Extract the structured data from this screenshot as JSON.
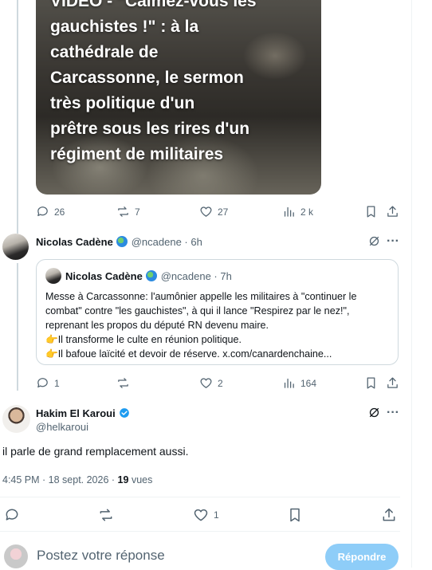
{
  "media_card": {
    "caption_lines": [
      "VIDÉO - \"Calmez-vous les",
      "gauchistes !\" : à la",
      "cathédrale de",
      "Carcassonne, le sermon",
      "très politique d'un",
      "prêtre sous les rires d'un",
      "régiment de militaires"
    ]
  },
  "post1_actions": {
    "replies": "26",
    "reposts": "7",
    "likes": "27",
    "views": "2 k"
  },
  "reply_post": {
    "author_name": "Nicolas Cadène",
    "handle_time": "@ncadene · 6h",
    "quote": {
      "author_name": "Nicolas Cadène",
      "handle_time": "@ncadene · 7h",
      "lines": [
        "Messe à Carcassonne: l'aumônier appelle les militaires à \"continuer le",
        "combat\" contre \"les gauchistes\", à qui il lance \"Respirez par le nez!\",",
        "reprenant les propos du député RN devenu maire.",
        "Il transforme le culte en réunion politique.",
        "Il bafoue laïcité et devoir de réserve. x.com/canardenchaine..."
      ]
    },
    "actions": {
      "replies": "1",
      "reposts": "",
      "likes": "2",
      "views": "164"
    }
  },
  "main_post": {
    "author_name": "Hakim El Karoui",
    "handle": "@helkaroui",
    "text": "il parle de grand remplacement aussi.",
    "timestamp": "4:45 PM · 18 sept. 2026 ·",
    "views_count": "19",
    "views_label": "vues",
    "actions": {
      "likes": "1"
    }
  },
  "reply_composer": {
    "placeholder": "Postez votre réponse",
    "button_label": "Répondre"
  },
  "colors": {
    "accent": "#1d9bf0",
    "reply_button": "#8ecdf8",
    "muted_text": "#536471",
    "divider": "#eff3f4"
  }
}
